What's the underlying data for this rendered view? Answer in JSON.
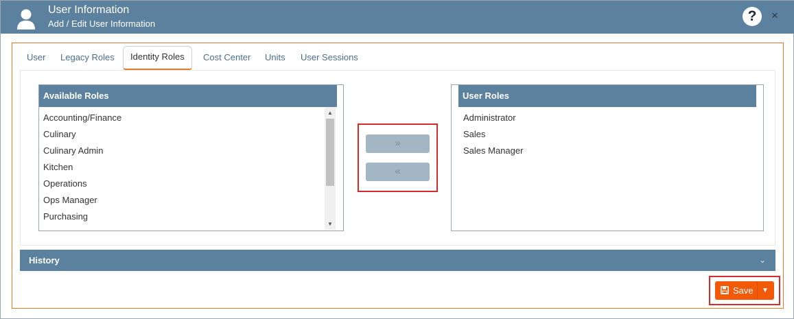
{
  "header": {
    "title": "User Information",
    "subtitle": "Add / Edit User Information",
    "help_icon": "question-circle-icon",
    "help_glyph": "?",
    "close_icon": "close-icon",
    "close_glyph": "×"
  },
  "tabs": [
    {
      "label": "User",
      "active": false
    },
    {
      "label": "Legacy Roles",
      "active": false
    },
    {
      "label": "Identity Roles",
      "active": true
    },
    {
      "label": "Cost Center",
      "active": false
    },
    {
      "label": "Units",
      "active": false
    },
    {
      "label": "User Sessions",
      "active": false
    }
  ],
  "available_roles": {
    "header": "Available Roles",
    "items": [
      "Accounting/Finance",
      "Culinary",
      "Culinary Admin",
      "Kitchen",
      "Operations",
      "Ops Manager",
      "Purchasing"
    ]
  },
  "user_roles": {
    "header": "User Roles",
    "items": [
      "Administrator",
      "Sales",
      "Sales Manager"
    ]
  },
  "transfer": {
    "add_glyph": "»",
    "remove_glyph": "«"
  },
  "history": {
    "label": "History",
    "chevron_glyph": "⌄"
  },
  "save": {
    "label": "Save",
    "caret_glyph": "▼"
  },
  "colors": {
    "header_bg": "#5b819e",
    "accent_orange": "#f25a0a",
    "highlight_red": "#d42c2c",
    "content_border": "#e8782a"
  }
}
